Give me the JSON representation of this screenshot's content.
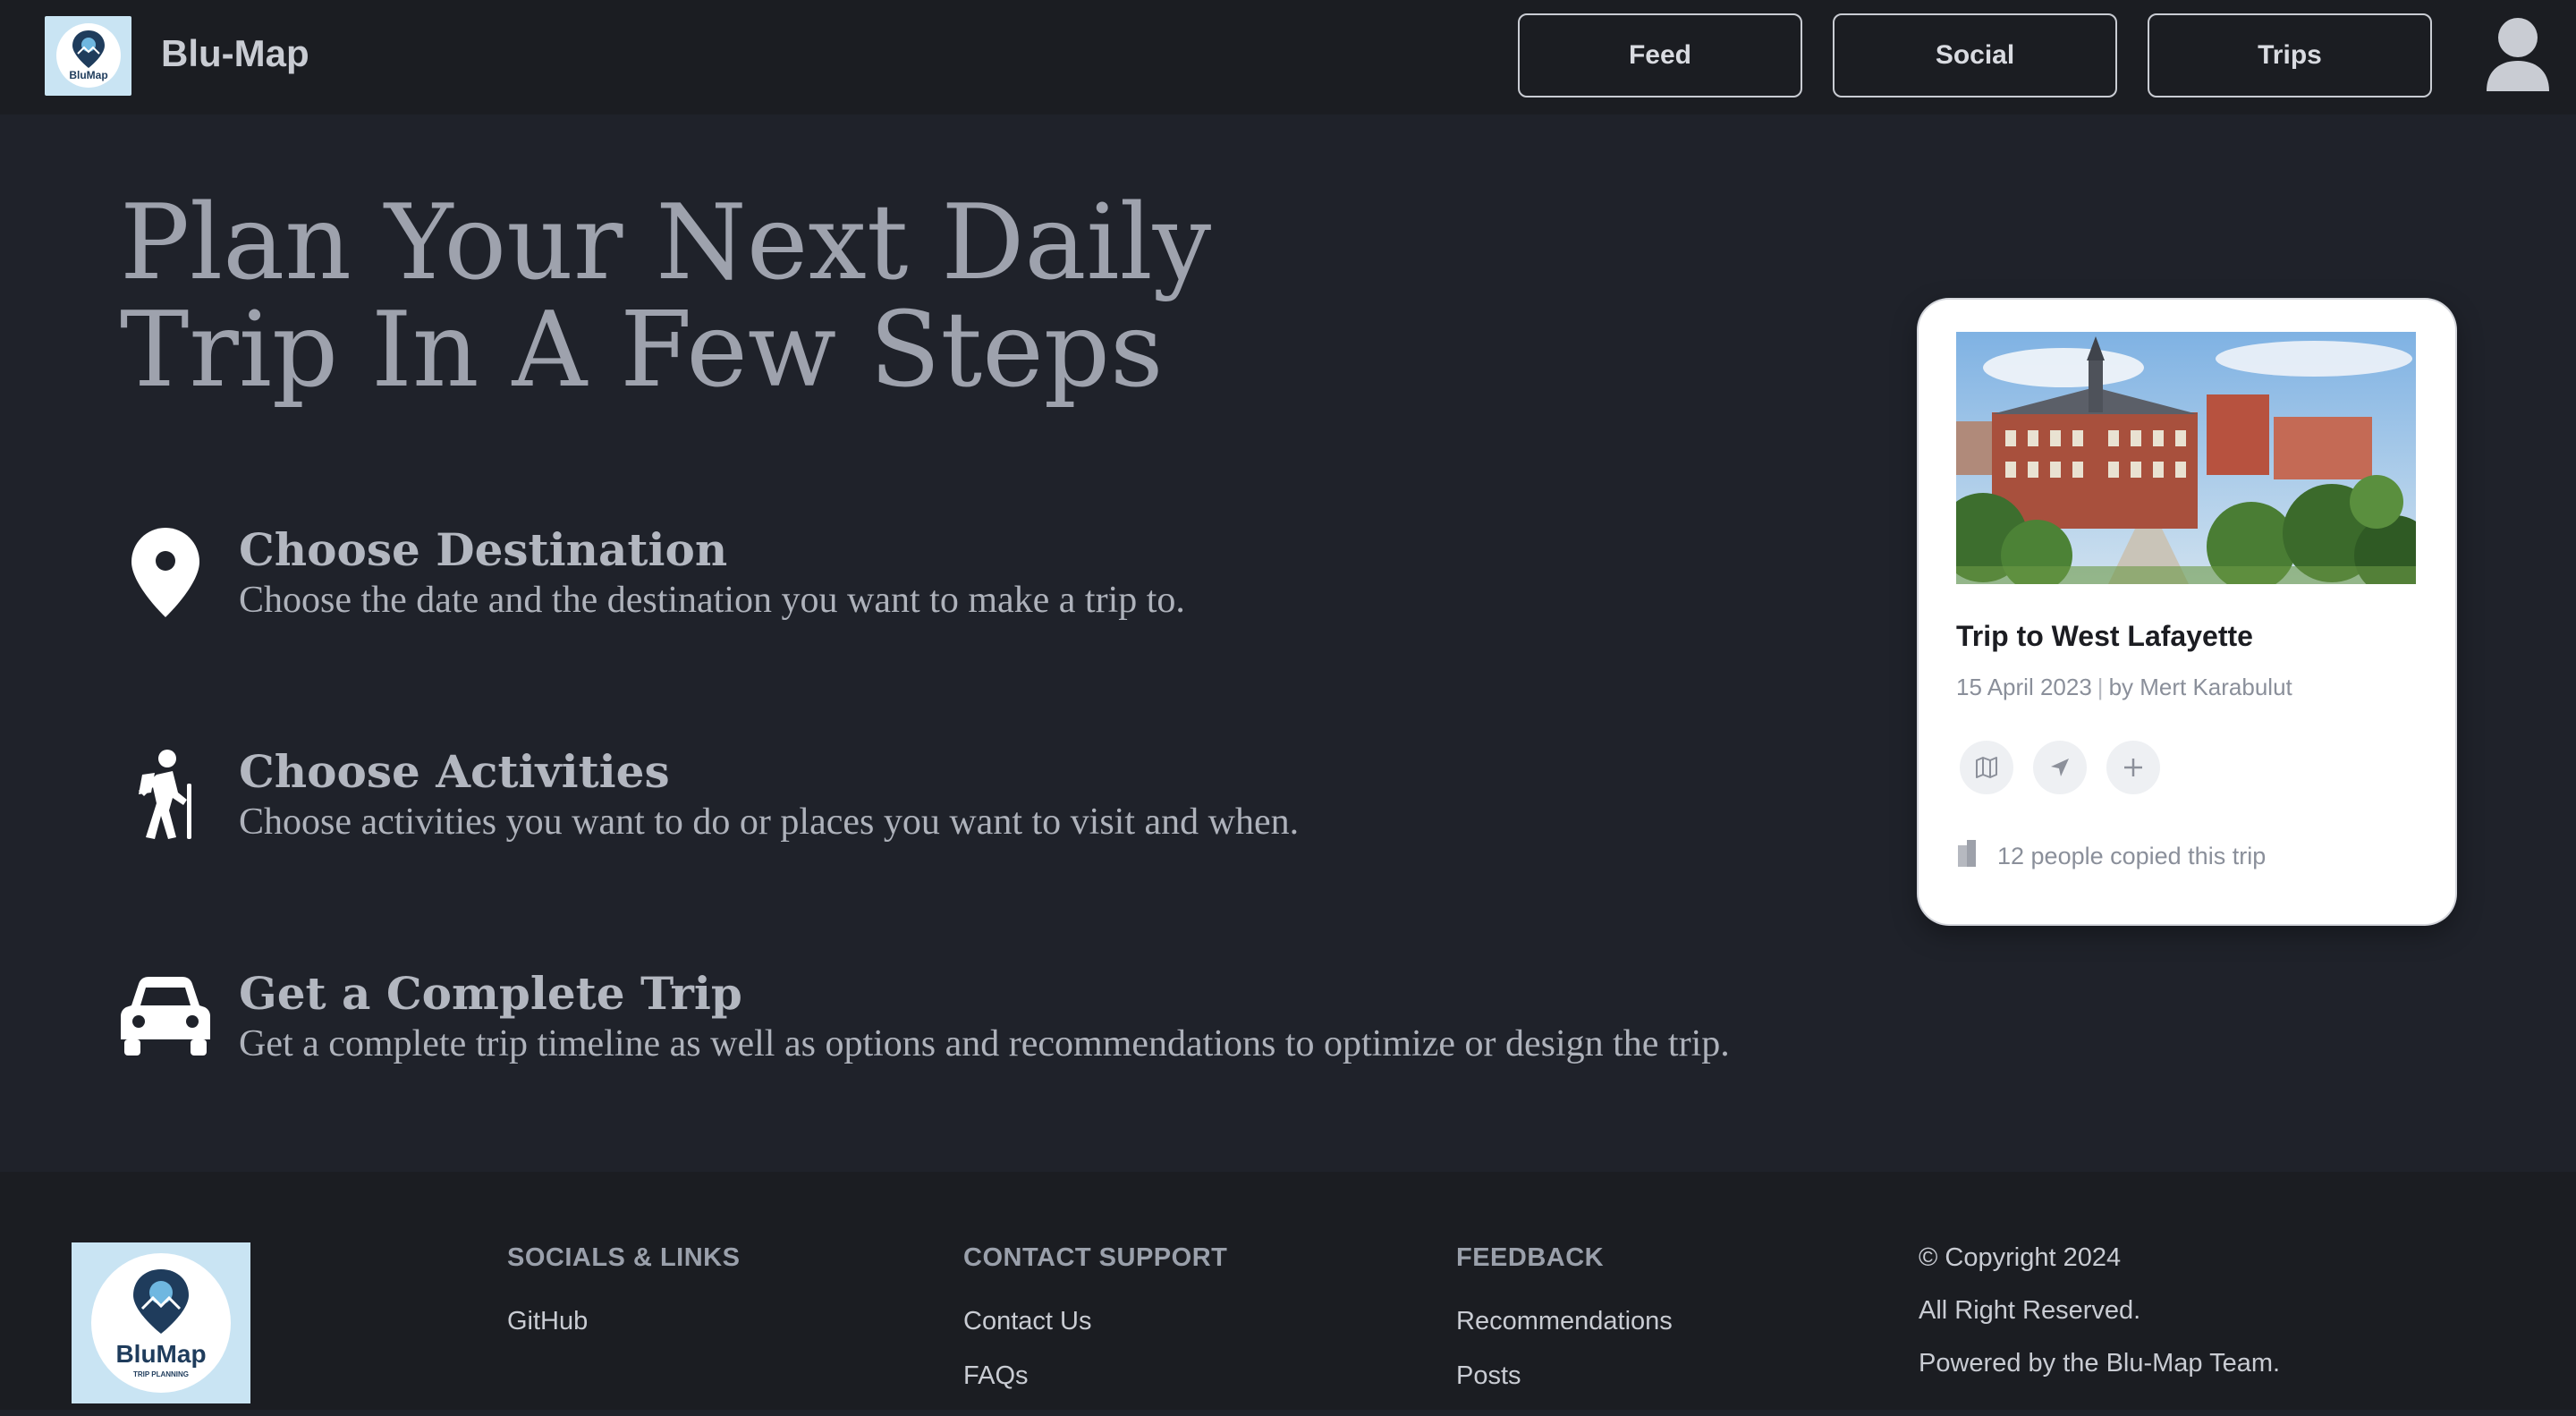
{
  "header": {
    "brand": "Blu-Map",
    "logo_text": "BluMap",
    "nav": [
      {
        "label": "Feed"
      },
      {
        "label": "Social"
      },
      {
        "label": "Trips"
      }
    ],
    "user_icon": "user-avatar-icon"
  },
  "hero": {
    "title_line1": "Plan Your Next Daily",
    "title_line2": "Trip In A Few Steps",
    "steps": [
      {
        "icon": "map-pin-icon",
        "title": "Choose Destination",
        "description": "Choose the date and the destination you want to make a trip to."
      },
      {
        "icon": "hiker-icon",
        "title": "Choose Activities",
        "description": "Choose activities you want to do or places you want to visit and when."
      },
      {
        "icon": "car-icon",
        "title": "Get a Complete Trip",
        "description": "Get a complete trip timeline as well as options and recommendations to optimize or design the trip."
      }
    ]
  },
  "trip_card": {
    "title": "Trip to West Lafayette",
    "day": "15",
    "month_year": "April 2023",
    "author": "by Mert Karabulut",
    "actions": [
      "map-icon",
      "navigate-icon",
      "plus-icon"
    ],
    "copies_text": "12 people copied this trip"
  },
  "footer": {
    "logo_text": "BluMap",
    "logo_subtext": "TRIP PLANNING",
    "socials": {
      "heading": "SOCIALS & LINKS",
      "links": [
        "GitHub"
      ]
    },
    "contact": {
      "heading": "CONTACT SUPPORT",
      "links": [
        "Contact Us",
        "FAQs"
      ]
    },
    "feedback": {
      "heading": "FEEDBACK",
      "links": [
        "Recommendations",
        "Posts"
      ]
    },
    "copyright": {
      "line1": "© Copyright 2024",
      "line2": "All Right Reserved.",
      "line3": "Powered by the Blu-Map Team."
    }
  },
  "colors": {
    "background": "#1f222a",
    "topbar": "#1b1d22",
    "logo_bg": "#c9e4f3",
    "logo_navy": "#1f3c5c"
  }
}
